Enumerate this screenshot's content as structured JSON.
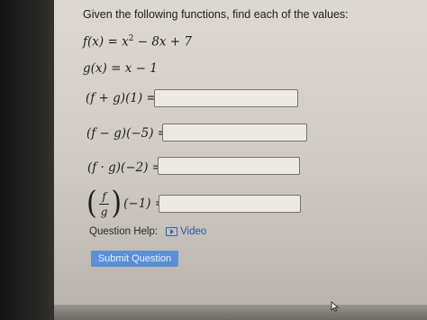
{
  "instructions": "Given the following functions, find each of the values:",
  "functions": [
    {
      "lhs": "f(x)",
      "rhs_before_exp": "x",
      "exponent": "2",
      "rhs_after_exp": " − 8x + 7"
    },
    {
      "lhs": "g(x)",
      "rhs": "x − 1"
    }
  ],
  "questions": [
    {
      "label": "(f + g)(1) =",
      "value": ""
    },
    {
      "label": "(f − g)(−5) =",
      "value": ""
    },
    {
      "label": "(f · g)(−2) =",
      "value": ""
    },
    {
      "numerator": "f",
      "denominator": "g",
      "suffix": "(−1) =",
      "value": ""
    }
  ],
  "help": {
    "label": "Question Help:",
    "video_label": "Video"
  },
  "submit_label": "Submit Question",
  "colors": {
    "accent": "#5b8fd8",
    "link": "#2f56a7"
  },
  "icons": [
    "video-icon",
    "mouse-cursor-icon"
  ]
}
